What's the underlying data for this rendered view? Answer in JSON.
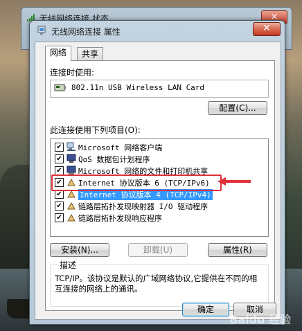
{
  "background_window": {
    "title": "无线网络连接 状态",
    "close": "×"
  },
  "window": {
    "title": "无线网络连接 属性",
    "close": "✕"
  },
  "tabs": [
    "网络",
    "共享"
  ],
  "connect_using_label": "连接时使用:",
  "adapter": "802.11n USB Wireless LAN Card",
  "configure_button": "配置(C)...",
  "items_label": "此连接使用下列项目(O):",
  "items": [
    {
      "label": "Microsoft 网络客户端",
      "checked": true,
      "icon": "network-client-icon"
    },
    {
      "label": "QoS 数据包计划程序",
      "checked": true,
      "icon": "qos-icon"
    },
    {
      "label": "Microsoft 网络的文件和打印机共享",
      "checked": true,
      "icon": "file-share-icon"
    },
    {
      "label": "Internet 协议版本 6 (TCP/IPv6)",
      "checked": true,
      "icon": "protocol-icon"
    },
    {
      "label": "Internet 协议版本 4 (TCP/IPv4)",
      "checked": true,
      "icon": "protocol-icon",
      "selected": true
    },
    {
      "label": "链路层拓扑发现映射器 I/O 驱动程序",
      "checked": true,
      "icon": "protocol-icon"
    },
    {
      "label": "链路层拓扑发现响应程序",
      "checked": true,
      "icon": "protocol-icon"
    }
  ],
  "buttons": {
    "install": "安装(N)...",
    "uninstall": "卸载(U)",
    "properties": "属性(R)",
    "ok": "确定",
    "cancel": "取消"
  },
  "description": {
    "title": "描述",
    "text": "TCP/IP。该协议是默认的广域网络协议,它提供在不同的相互连接的网络上的通讯。"
  },
  "watermark": "Baidu 经验",
  "colors": {
    "selection": "#3399ff",
    "annotation": "#e0303a"
  }
}
